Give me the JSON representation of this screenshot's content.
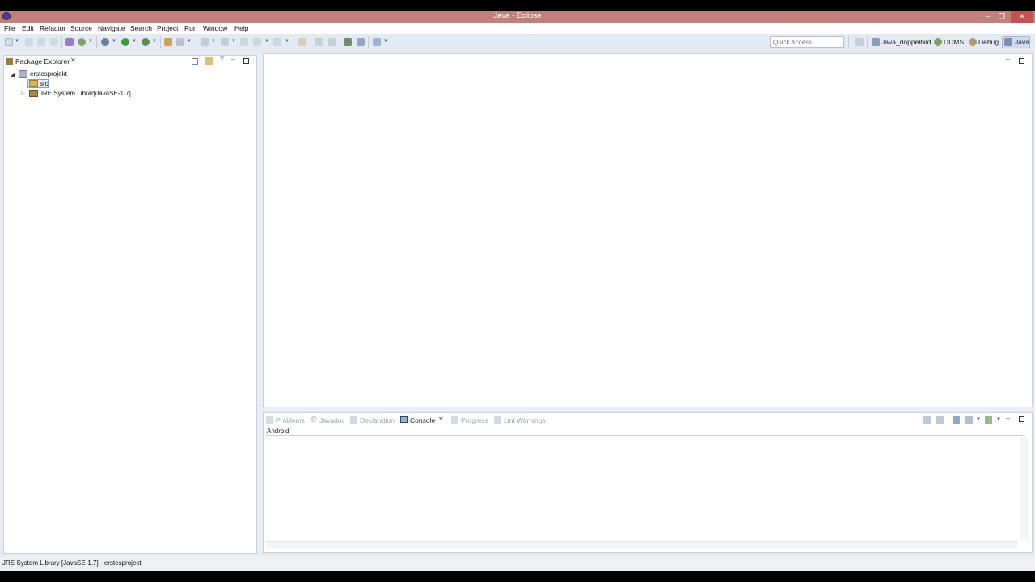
{
  "window": {
    "title": "Java - Eclipse",
    "buttons": {
      "minimize": "–",
      "restore": "❐",
      "close": "✕"
    }
  },
  "menu": [
    "File",
    "Edit",
    "Refactor",
    "Source",
    "Navigate",
    "Search",
    "Project",
    "Run",
    "Window",
    "Help"
  ],
  "toolbar": {
    "quick_access_placeholder": "Quick Access",
    "perspectives": [
      "Java_doppelbild",
      "DDMS",
      "Debug",
      "Java"
    ],
    "active_perspective": "Java"
  },
  "package_explorer": {
    "tab_label": "Package Explorer",
    "tree": {
      "project": "erstesprojekt",
      "children": [
        {
          "label": "src",
          "suffix": ""
        },
        {
          "label": "JRE System Library",
          "suffix": "[JavaSE-1.7]"
        }
      ]
    }
  },
  "bottom_panel": {
    "tabs": [
      "Problems",
      "Javadoc",
      "Declaration",
      "Console",
      "Progress",
      "Lint Warnings"
    ],
    "active_tab": "Console",
    "console_name": "Android"
  },
  "status": {
    "text": "JRE System Library [JavaSE-1.7] - erstesprojekt"
  },
  "colors": {
    "titlebar": "#c2807a",
    "workbench": "#e8ecf3",
    "accent": "#3d6fb0"
  }
}
